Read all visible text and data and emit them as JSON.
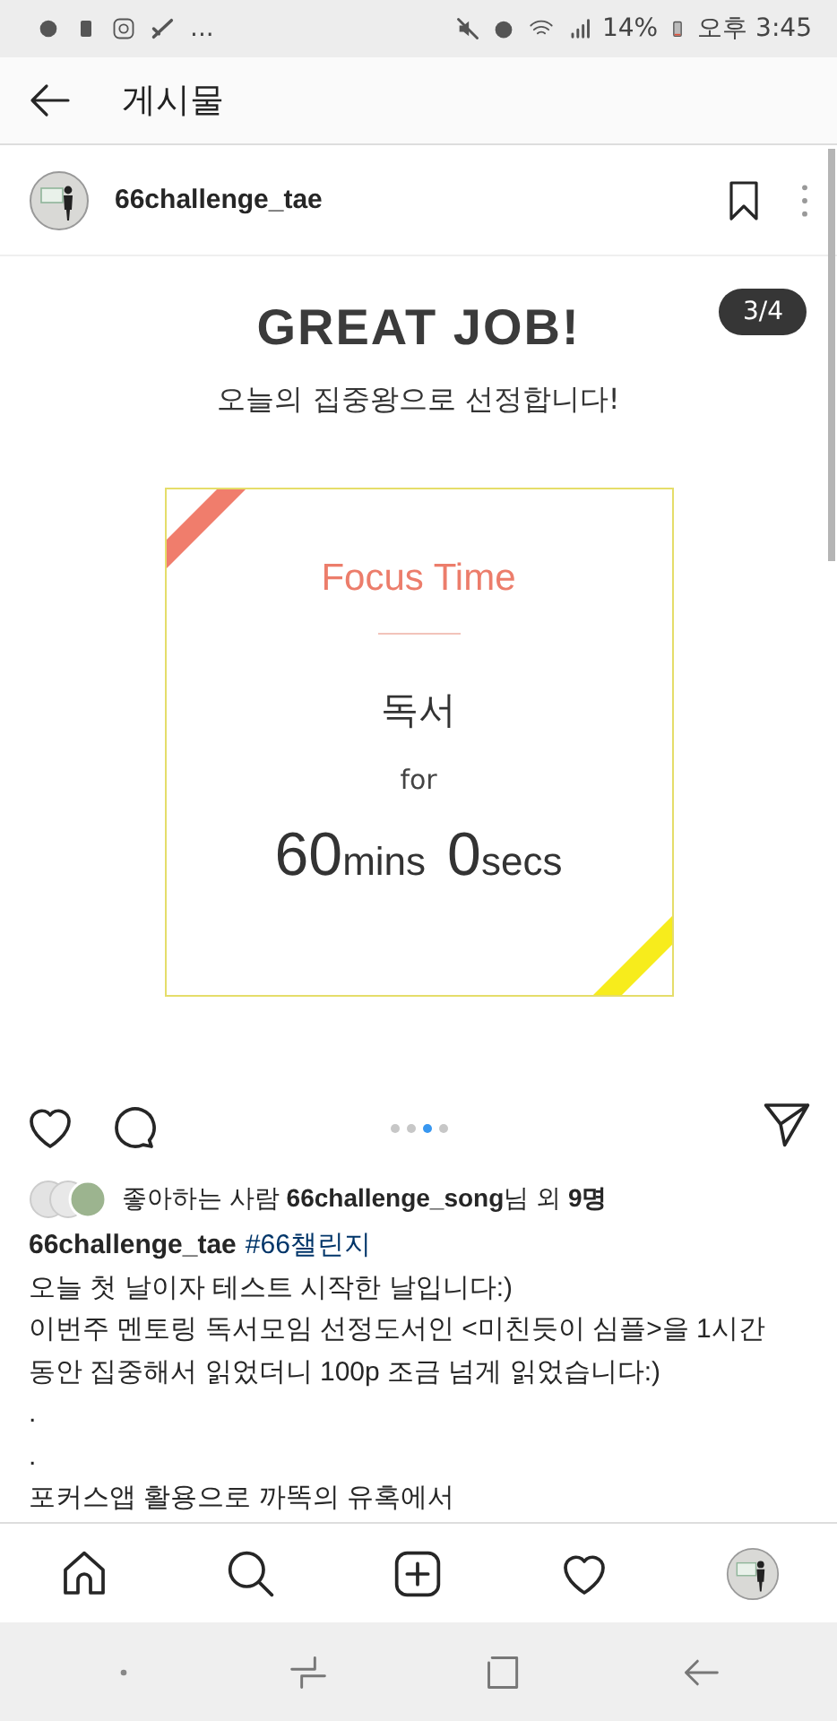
{
  "status_bar": {
    "overflow": "...",
    "battery": "14%",
    "time": "오후 3:45"
  },
  "header": {
    "title": "게시물"
  },
  "post": {
    "username": "66challenge_tae",
    "page_badge": "3/4",
    "card": {
      "headline": "GREAT JOB!",
      "subtitle": "오늘의 집중왕으로 선정합니다!",
      "title": "Focus Time",
      "activity": "독서",
      "for": "for",
      "duration": [
        {
          "kind": "number",
          "text": "60"
        },
        {
          "kind": "unit",
          "text": "mins"
        },
        {
          "kind": "number",
          "text": "0"
        },
        {
          "kind": "unit",
          "text": "secs"
        }
      ]
    },
    "dots": [
      {
        "selected": false
      },
      {
        "selected": false
      },
      {
        "selected": true
      },
      {
        "selected": false
      }
    ],
    "likes": "좋아하는 사람 **66challenge_song**님 외 **9명**",
    "caption": {
      "username": "66challenge_tae",
      "hashtag": "#66챌린지",
      "lines": [
        "오늘 첫 날이자 테스트 시작한 날입니다:)",
        "이번주 멘토링 독서모임 선정도서인 <미친듯이 심플>을 1시간",
        "동안 집중해서 읽었더니 100p 조금 넘게 읽었습니다:)",
        ".",
        ".",
        "포커스앱 활용으로 까똑의 유혹에서"
      ]
    }
  }
}
